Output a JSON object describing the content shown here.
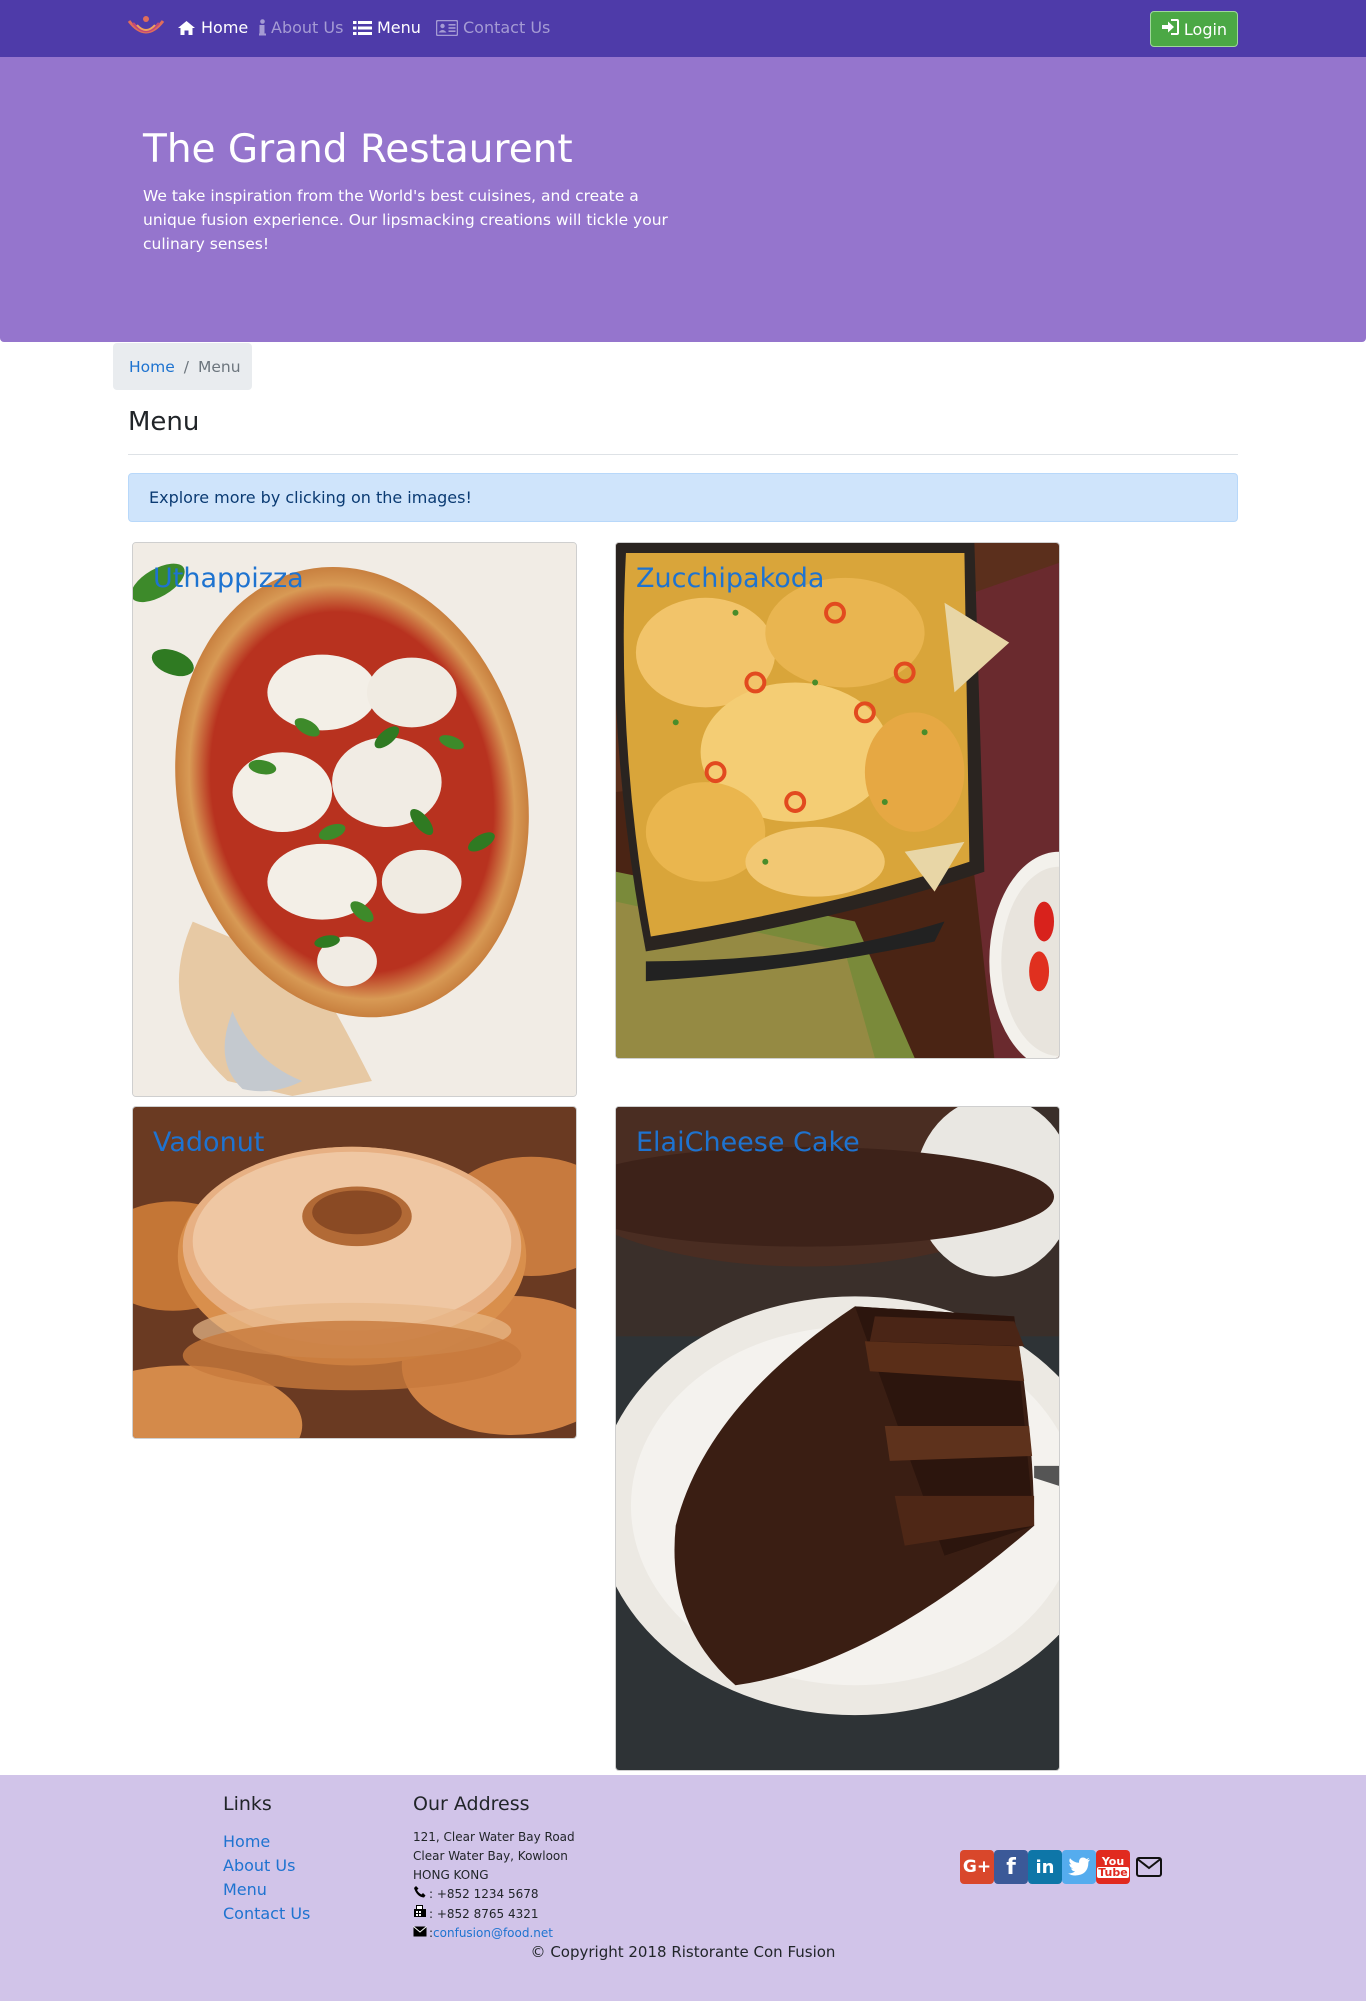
{
  "nav": {
    "items": [
      {
        "label": "Home",
        "icon": "home-icon",
        "state": "active"
      },
      {
        "label": "About Us",
        "icon": "info-icon",
        "state": "inactive"
      },
      {
        "label": "Menu",
        "icon": "list-icon",
        "state": "active"
      },
      {
        "label": "Contact Us",
        "icon": "address-card-icon",
        "state": "inactive"
      }
    ],
    "login_label": "Login"
  },
  "jumbotron": {
    "title": "The Grand Restaurent",
    "text": "We take inspiration from the World's best cuisines, and create a unique fusion experience. Our lipsmacking creations will tickle your culinary senses!"
  },
  "breadcrumb": {
    "home": "Home",
    "separator": "/",
    "current": "Menu"
  },
  "page_title": "Menu",
  "alert_text": "Explore more by clicking on the images!",
  "dishes": [
    {
      "name": "Uthappizza",
      "image": "pizza"
    },
    {
      "name": "Zucchipakoda",
      "image": "nachos"
    },
    {
      "name": "Vadonut",
      "image": "donut"
    },
    {
      "name": "ElaiCheese Cake",
      "image": "chocolate-cake"
    }
  ],
  "footer": {
    "links_heading": "Links",
    "links": [
      "Home",
      "About Us",
      "Menu",
      "Contact Us"
    ],
    "address_heading": "Our Address",
    "address_lines": [
      "121, Clear Water Bay Road",
      "Clear Water Bay, Kowloon",
      "HONG KONG"
    ],
    "phone": ": +852 1234 5678",
    "fax": ": +852 8765 4321",
    "email_prefix": ": ",
    "email": "confusion@food.net",
    "social": [
      "google-plus-icon",
      "facebook-icon",
      "linkedin-icon",
      "twitter-icon",
      "youtube-icon",
      "envelope-icon"
    ],
    "copyright": "© Copyright 2018 Ristorante Con Fusion"
  },
  "colors": {
    "navbar": "#4e3ba9",
    "jumbotron": "#9575cd",
    "footer": "#d1c4e9",
    "link": "#1e73d0",
    "login_button": "#4ba845"
  }
}
